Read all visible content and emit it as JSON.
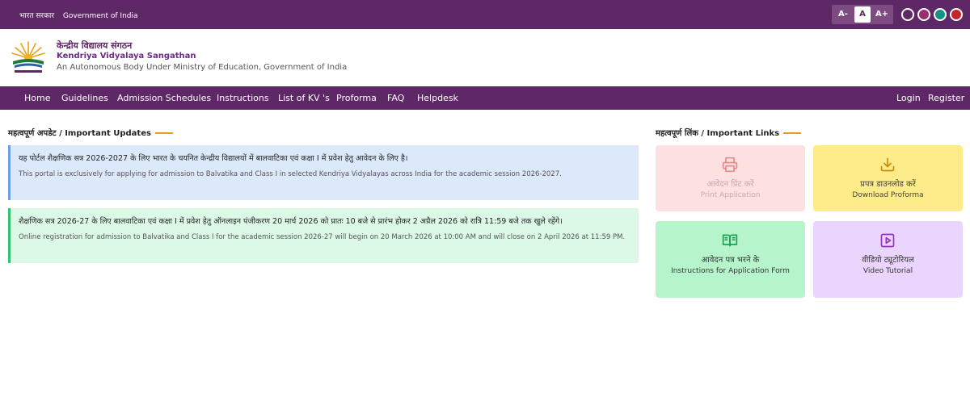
{
  "topbar": {
    "gov_hi": "भारत सरकार",
    "gov_en": "Government of India",
    "font_decrease": "A-",
    "font_normal": "A",
    "font_increase": "A+",
    "theme_colors": [
      "#ffffff",
      "#9b2e73",
      "#168f8a",
      "#c5262b"
    ]
  },
  "header": {
    "logo_icon": "kvs-logo-icon",
    "title_hi": "केन्द्रीय विद्यालय संगठन",
    "title_en": "Kendriya Vidyalaya Sangathan",
    "subtitle": "An Autonomous Body Under Ministry of Education, Government of India"
  },
  "nav": {
    "items": [
      "Home",
      "Guidelines",
      "Admission Schedules",
      "Instructions",
      "List of KV 's",
      "Proforma",
      "FAQ",
      "Helpdesk"
    ],
    "login": "Login",
    "register": "Register"
  },
  "updates": {
    "title": "महत्वपूर्ण अपडेट / Important Updates",
    "items": [
      {
        "hi": "यह पोर्टल शैक्षणिक सत्र 2026-2027 के लिए भारत के चयनित केन्द्रीय विद्यालयों में बालवाटिका एवं कक्षा I में प्रवेश हेतु आवेदन के लिए है।",
        "en": "This portal is exclusively for applying for admission to Balvatika and Class I in selected Kendriya Vidyalayas across India for the academic session 2026-2027."
      },
      {
        "hi": "शैक्षणिक सत्र 2026-27 के लिए बालवाटिका एवं कक्षा I में प्रवेश हेतु ऑनलाइन पंजीकरण 20 मार्च 2026 को प्रातः 10 बजे से प्रारंभ होकर 2 अप्रैल 2026 को रात्रि 11:59 बजे तक खुले रहेंगे।",
        "en": "Online registration for admission to Balvatika and Class I for the academic session 2026-27 will begin on 20 March 2026 at 10:00 AM and will close on 2 April 2026 at 11:59 PM."
      }
    ]
  },
  "links": {
    "title": "महत्वपूर्ण लिंक / Important Links",
    "cards": [
      {
        "icon": "printer-icon",
        "hi": "आवेदन प्रिंट करें",
        "en": "Print Application"
      },
      {
        "icon": "download-icon",
        "hi": "प्रपत्र डाउनलोड करें",
        "en": "Download Proforma"
      },
      {
        "icon": "book-open-icon",
        "hi": "आवेदन पत्र भरने के",
        "en": "Instructions for Application Form"
      },
      {
        "icon": "video-play-icon",
        "hi": "वीडियो ट्यूटोरियल",
        "en": "Video Tutorial"
      }
    ]
  }
}
